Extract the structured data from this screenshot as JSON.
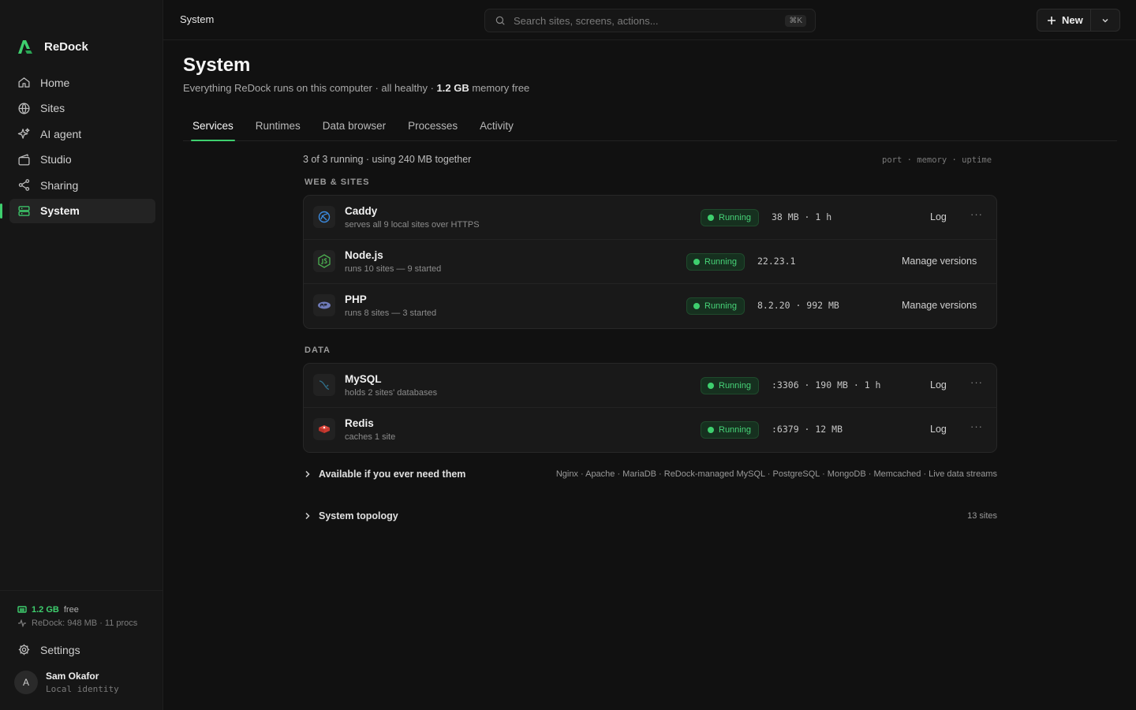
{
  "app": {
    "name": "ReDock"
  },
  "sidebar": {
    "items": [
      {
        "label": "Home",
        "icon": "home-icon"
      },
      {
        "label": "Sites",
        "icon": "globe-icon"
      },
      {
        "label": "AI agent",
        "icon": "sparkle-icon"
      },
      {
        "label": "Studio",
        "icon": "studio-icon"
      },
      {
        "label": "Sharing",
        "icon": "share-icon"
      },
      {
        "label": "System",
        "icon": "server-icon",
        "active": true
      }
    ],
    "memory": {
      "value": "1.2 GB",
      "suffix": "free"
    },
    "procs": "ReDock: 948 MB · 11 procs",
    "settings_label": "Settings",
    "user": {
      "initial": "A",
      "name": "Sam Okafor",
      "sub": "Local identity"
    }
  },
  "topbar": {
    "breadcrumb": "System",
    "search_placeholder": "Search sites, screens, actions...",
    "shortcut": "⌘K",
    "new_label": "New"
  },
  "header": {
    "title": "System",
    "subtitle_pre": "Everything ReDock runs on this computer · all healthy · ",
    "subtitle_bold": "1.2 GB",
    "subtitle_post": " memory free"
  },
  "tabs": [
    "Services",
    "Runtimes",
    "Data browser",
    "Processes",
    "Activity"
  ],
  "services": {
    "summary": "3 of 3 running · using 240 MB together",
    "legend": "port · memory · uptime",
    "sections": [
      {
        "label": "WEB & SITES",
        "rows": [
          {
            "name": "Caddy",
            "desc": "serves all 9 local sites over HTTPS",
            "status": "Running",
            "metrics": "38 MB · 1 h",
            "action": "Log",
            "more": true
          },
          {
            "name": "Node.js",
            "desc": "runs 10 sites — 9 started",
            "status": "Running",
            "metrics": "22.23.1",
            "action": "Manage versions",
            "more": false
          },
          {
            "name": "PHP",
            "desc": "runs 8 sites — 3 started",
            "status": "Running",
            "metrics": "8.2.20 · 992 MB",
            "action": "Manage versions",
            "more": false
          }
        ]
      },
      {
        "label": "DATA",
        "rows": [
          {
            "name": "MySQL",
            "desc": "holds 2 sites' databases",
            "status": "Running",
            "metrics": ":3306 · 190 MB · 1 h",
            "action": "Log",
            "more": true
          },
          {
            "name": "Redis",
            "desc": "caches 1 site",
            "status": "Running",
            "metrics": ":6379 · 12 MB",
            "action": "Log",
            "more": true
          }
        ]
      }
    ],
    "available": {
      "label": "Available if you ever need them",
      "list": "Nginx · Apache · MariaDB · ReDock-managed MySQL · PostgreSQL · MongoDB · Memcached · Live data streams"
    },
    "topology": {
      "label": "System topology",
      "count": "13 sites"
    },
    "more_glyph": "···"
  },
  "colors": {
    "accent": "#3ecf6e",
    "background": "#111111",
    "sidebar": "#161616"
  }
}
